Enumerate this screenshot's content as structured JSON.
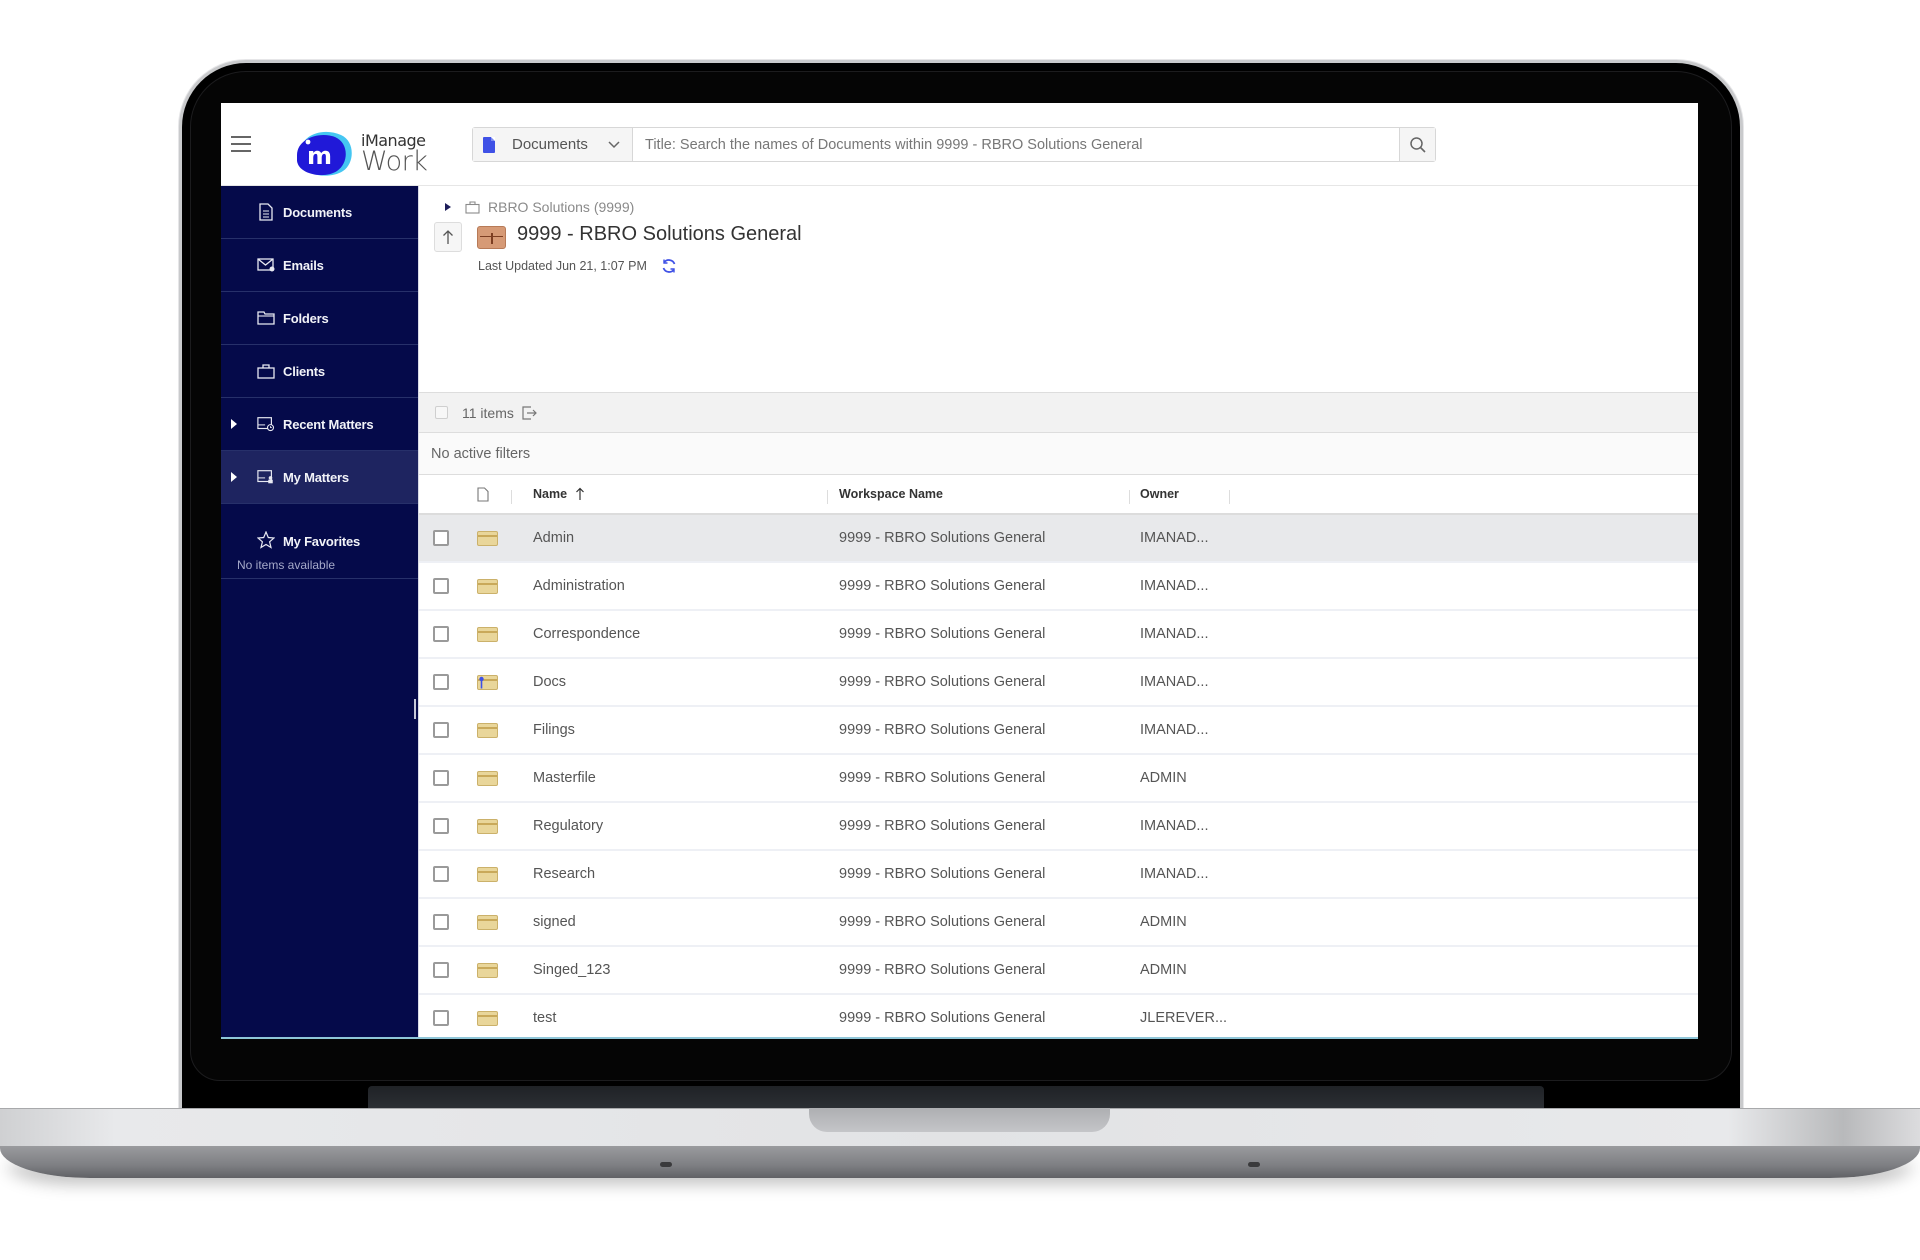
{
  "app": {
    "brand_small": "iManage",
    "brand_big": "Work"
  },
  "search": {
    "scope_label": "Documents",
    "scope_icon": "document-icon",
    "placeholder": "Title: Search the names of Documents within 9999 - RBRO Solutions General",
    "value": "",
    "button_icon": "search-icon"
  },
  "sidebar": {
    "items": [
      {
        "label": "Documents",
        "icon": "document-icon",
        "expandable": false,
        "active": false
      },
      {
        "label": "Emails",
        "icon": "email-icon",
        "expandable": false,
        "active": false
      },
      {
        "label": "Folders",
        "icon": "folder-icon",
        "expandable": false,
        "active": false
      },
      {
        "label": "Clients",
        "icon": "briefcase-icon",
        "expandable": false,
        "active": false
      },
      {
        "label": "Recent Matters",
        "icon": "recent-matters-icon",
        "expandable": true,
        "active": false
      },
      {
        "label": "My Matters",
        "icon": "my-matters-icon",
        "expandable": true,
        "active": true
      },
      {
        "label": "My Favorites",
        "icon": "star-icon",
        "expandable": false,
        "active": false
      }
    ],
    "favorites_empty": "No items available"
  },
  "workspace": {
    "breadcrumb_parent": "RBRO Solutions (9999)",
    "title": "9999 - RBRO Solutions General",
    "last_updated": "Last Updated Jun 21, 1:07 PM"
  },
  "list": {
    "count_label": "11 items",
    "filters_label": "No active filters",
    "columns": {
      "name": "Name",
      "workspace": "Workspace Name",
      "owner": "Owner"
    },
    "sort": {
      "column": "name",
      "direction": "ascending"
    },
    "colors": {
      "folder": "#e9d69a",
      "selected_row": "#e8e9eb",
      "sidebar": "#050a4a",
      "accent": "#3f51e6"
    },
    "rows": [
      {
        "name": "Admin",
        "workspace": "9999 - RBRO Solutions General",
        "owner": "IMANAD...",
        "type": "folder",
        "selected": true
      },
      {
        "name": "Administration",
        "workspace": "9999 - RBRO Solutions General",
        "owner": "IMANAD...",
        "type": "folder",
        "selected": false
      },
      {
        "name": "Correspondence",
        "workspace": "9999 - RBRO Solutions General",
        "owner": "IMANAD...",
        "type": "folder",
        "selected": false
      },
      {
        "name": "Docs",
        "workspace": "9999 - RBRO Solutions General",
        "owner": "IMANAD...",
        "type": "secured-folder",
        "selected": false
      },
      {
        "name": "Filings",
        "workspace": "9999 - RBRO Solutions General",
        "owner": "IMANAD...",
        "type": "folder",
        "selected": false
      },
      {
        "name": "Masterfile",
        "workspace": "9999 - RBRO Solutions General",
        "owner": "ADMIN",
        "type": "folder",
        "selected": false
      },
      {
        "name": "Regulatory",
        "workspace": "9999 - RBRO Solutions General",
        "owner": "IMANAD...",
        "type": "folder",
        "selected": false
      },
      {
        "name": "Research",
        "workspace": "9999 - RBRO Solutions General",
        "owner": "IMANAD...",
        "type": "folder",
        "selected": false
      },
      {
        "name": "signed",
        "workspace": "9999 - RBRO Solutions General",
        "owner": "ADMIN",
        "type": "folder",
        "selected": false
      },
      {
        "name": "Singed_123",
        "workspace": "9999 - RBRO Solutions General",
        "owner": "ADMIN",
        "type": "folder",
        "selected": false
      },
      {
        "name": "test",
        "workspace": "9999 - RBRO Solutions General",
        "owner": "JLEREVER...",
        "type": "folder",
        "selected": false
      }
    ]
  }
}
